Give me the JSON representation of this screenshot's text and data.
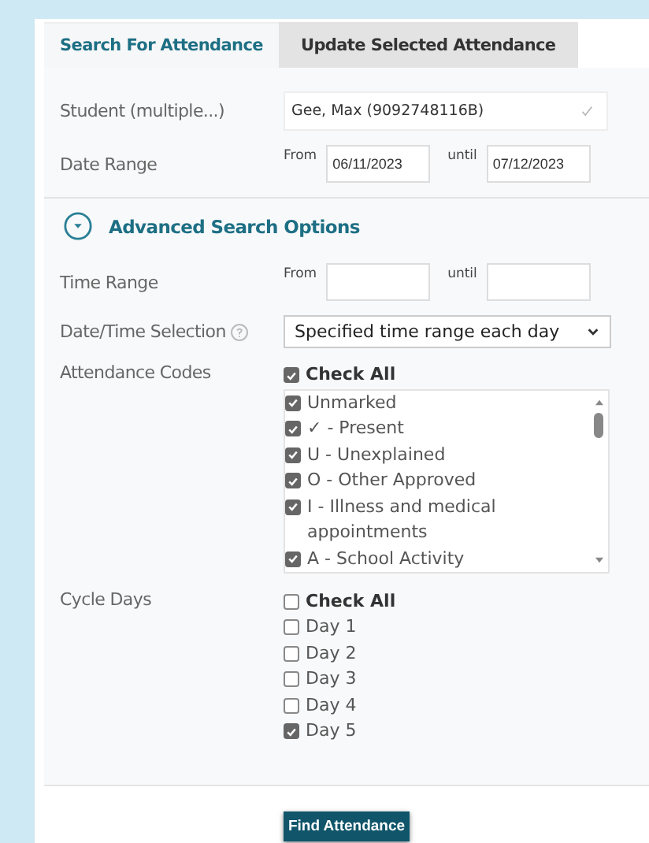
{
  "tabs": [
    {
      "label": "Search For Attendance",
      "selected": true
    },
    {
      "label": "Update Selected Attendance",
      "selected": false
    }
  ],
  "student": {
    "label": "Student (multiple...)",
    "value": "Gee, Max (9092748116B)"
  },
  "date_range": {
    "label": "Date Range",
    "from_label": "From",
    "from_value": "06/11/2023",
    "until_label": "until",
    "until_value": "07/12/2023"
  },
  "advanced": {
    "label": "Advanced Search Options",
    "expanded": true
  },
  "time_range": {
    "label": "Time Range",
    "from_label": "From",
    "until_label": "until"
  },
  "date_time_selection": {
    "label": "Date/Time Selection",
    "value": "Specified time range each day"
  },
  "attendance_codes": {
    "label": "Attendance Codes",
    "check_all": {
      "label": "Check All",
      "checked": true
    },
    "items": [
      {
        "label": "Unmarked",
        "checked": true
      },
      {
        "label": "✓ - Present",
        "checked": true
      },
      {
        "label": "U - Unexplained",
        "checked": true
      },
      {
        "label": "O - Other Approved",
        "checked": true
      },
      {
        "label": "I - Illness and medical appointments",
        "checked": true
      },
      {
        "label": "A - School Activity",
        "checked": true
      }
    ]
  },
  "cycle_days": {
    "label": "Cycle Days",
    "check_all": {
      "label": "Check All",
      "checked": false
    },
    "items": [
      {
        "label": "Day 1",
        "checked": false
      },
      {
        "label": "Day 2",
        "checked": false
      },
      {
        "label": "Day 3",
        "checked": false
      },
      {
        "label": "Day 4",
        "checked": false
      },
      {
        "label": "Day 5",
        "checked": true
      }
    ]
  },
  "button": "Find Attendance"
}
